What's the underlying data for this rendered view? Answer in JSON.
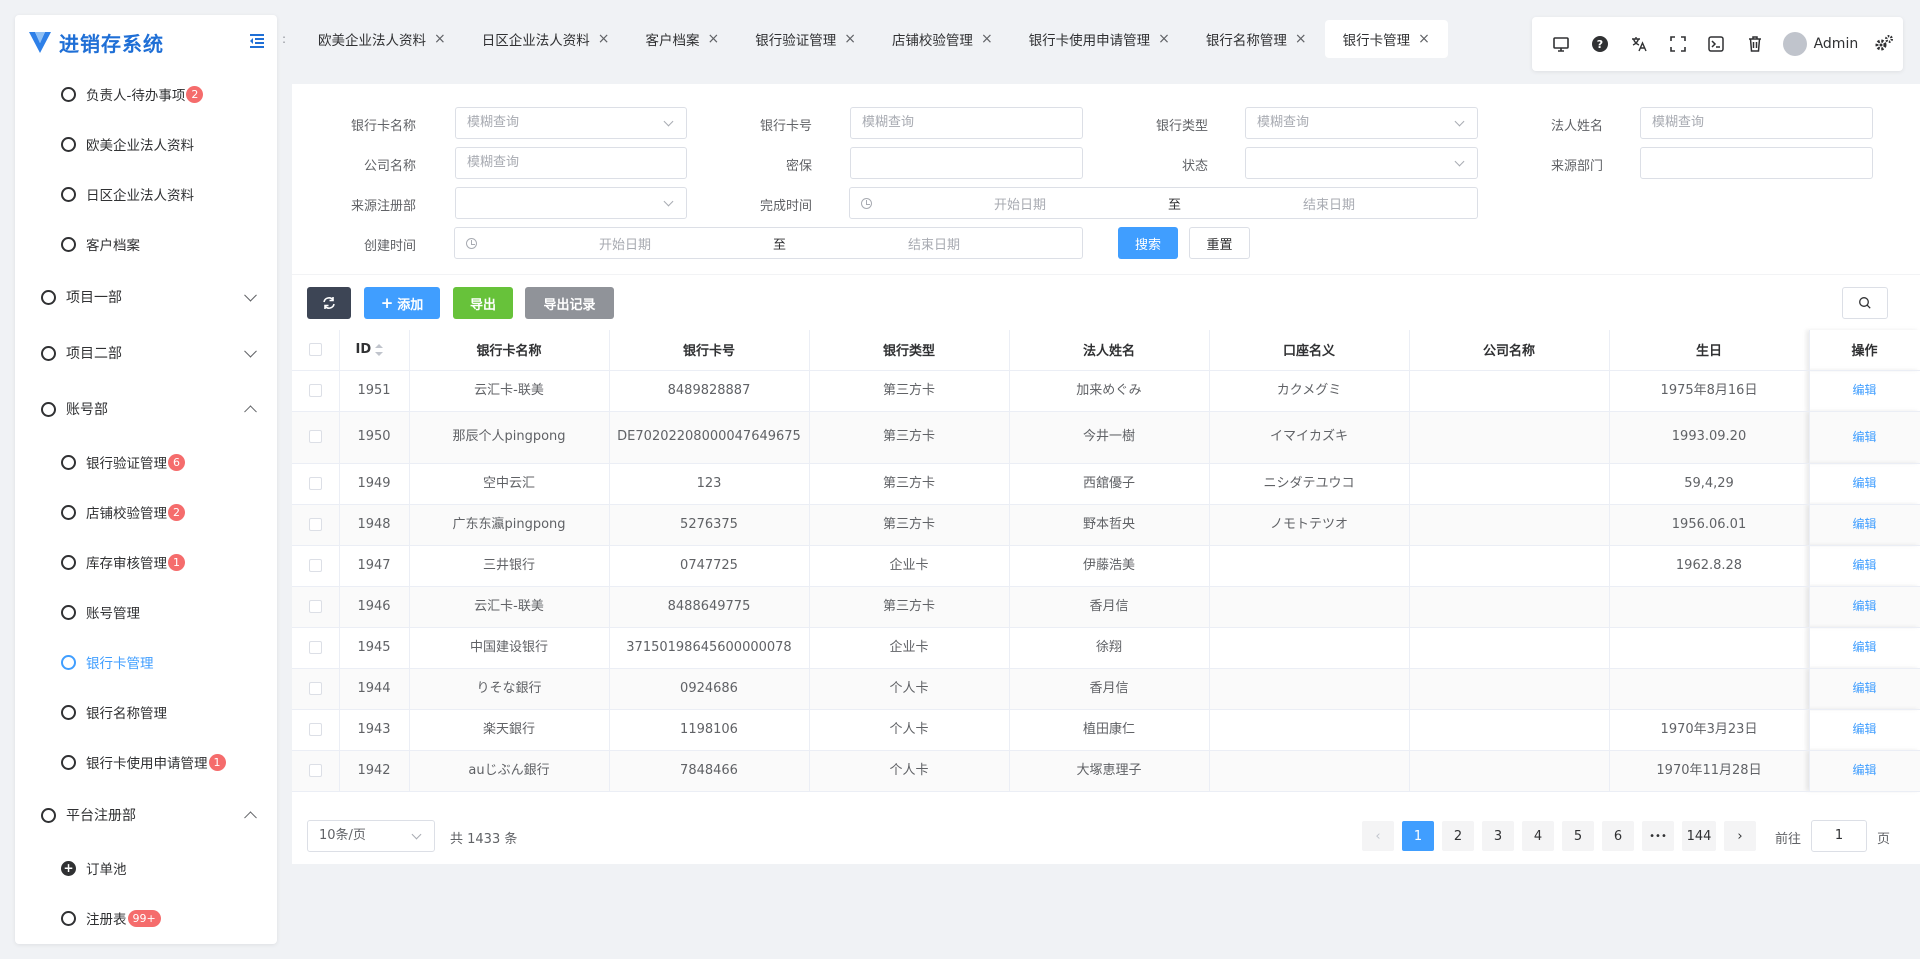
{
  "app": {
    "title": "进销存系统"
  },
  "sidebar": {
    "items": [
      {
        "label": "负责人-待办事项",
        "badge": "2"
      },
      {
        "label": "欧美企业法人资料"
      },
      {
        "label": "日区企业法人资料"
      },
      {
        "label": "客户档案"
      },
      {
        "label": "项目一部"
      },
      {
        "label": "项目二部"
      },
      {
        "label": "账号部"
      },
      {
        "label": "银行验证管理",
        "badge": "6"
      },
      {
        "label": "店铺校验管理",
        "badge": "2"
      },
      {
        "label": "库存审核管理",
        "badge": "1"
      },
      {
        "label": "账号管理"
      },
      {
        "label": "银行卡管理"
      },
      {
        "label": "银行名称管理"
      },
      {
        "label": "银行卡使用申请管理",
        "badge": "1"
      },
      {
        "label": "平台注册部"
      },
      {
        "label": "订单池"
      },
      {
        "label": "注册表",
        "badge": "99+"
      }
    ]
  },
  "tabs": [
    {
      "label": "欧美企业法人资料"
    },
    {
      "label": "日区企业法人资料"
    },
    {
      "label": "客户档案"
    },
    {
      "label": "银行验证管理"
    },
    {
      "label": "店铺校验管理"
    },
    {
      "label": "银行卡使用申请管理"
    },
    {
      "label": "银行名称管理"
    },
    {
      "label": "银行卡管理"
    }
  ],
  "topbar": {
    "user": "Admin",
    "tabs_scroll": ":"
  },
  "filter": {
    "card_name_label": "银行卡名称",
    "card_name_placeholder": "模糊查询",
    "card_no_label": "银行卡号",
    "card_no_placeholder": "模糊查询",
    "bank_type_label": "银行类型",
    "bank_type_placeholder": "模糊查询",
    "legal_name_label": "法人姓名",
    "legal_name_placeholder": "模糊查询",
    "company_label": "公司名称",
    "company_placeholder": "模糊查询",
    "secret_label": "密保",
    "status_label": "状态",
    "source_dept_label": "来源部门",
    "source_reg_label": "来源注册部",
    "finish_time_label": "完成时间",
    "create_time_label": "创建时间",
    "start_date": "开始日期",
    "to": "至",
    "end_date": "结束日期",
    "search_btn": "搜索",
    "reset_btn": "重置"
  },
  "toolbar": {
    "add": "添加",
    "export": "导出",
    "export_log": "导出记录"
  },
  "table": {
    "headers": [
      "ID",
      "银行卡名称",
      "银行卡号",
      "银行类型",
      "法人姓名",
      "口座名义",
      "公司名称",
      "生日",
      "操作"
    ],
    "edit_label": "编辑",
    "rows": [
      [
        "1951",
        "云汇卡-联美",
        "8489828887",
        "第三方卡",
        "加来めぐみ",
        "カクメグミ",
        "",
        "1975年8月16日"
      ],
      [
        "1950",
        "那辰个人pingpong",
        "DE70202208000047649675",
        "第三方卡",
        "今井一樹",
        "イマイカズキ",
        "",
        "1993.09.20"
      ],
      [
        "1949",
        "空中云汇",
        "123",
        "第三方卡",
        "西舘優子",
        "ニシダテユウコ",
        "",
        "59,4,29"
      ],
      [
        "1948",
        "广东东瀛pingpong",
        "5276375",
        "第三方卡",
        "野本哲央",
        "ノモトテツオ",
        "",
        "1956.06.01"
      ],
      [
        "1947",
        "三井银行",
        "0747725",
        "企业卡",
        "伊藤浩美",
        "",
        "",
        "1962.8.28"
      ],
      [
        "1946",
        "云汇卡-联美",
        "8488649775",
        "第三方卡",
        "香月信",
        "",
        "",
        ""
      ],
      [
        "1945",
        "中国建设银行",
        "37150198645600000078",
        "企业卡",
        "徐翔",
        "",
        "",
        ""
      ],
      [
        "1944",
        "りそな銀行",
        "0924686",
        "个人卡",
        "香月信",
        "",
        "",
        ""
      ],
      [
        "1943",
        "楽天銀行",
        "1198106",
        "个人卡",
        "植田康仁",
        "",
        "",
        "1970年3月23日"
      ],
      [
        "1942",
        "auじぶん銀行",
        "7848466",
        "个人卡",
        "大塚恵理子",
        "",
        "",
        "1970年11月28日"
      ]
    ]
  },
  "pagination": {
    "page_size": "10条/页",
    "total": "共 1433 条",
    "pages": [
      "1",
      "2",
      "3",
      "4",
      "5",
      "6",
      "•••",
      "144"
    ],
    "goto_label": "前往",
    "goto_value": "1",
    "page_unit": "页"
  },
  "colors": {
    "primary": "#409eff",
    "brand": "#1f6fd6",
    "success": "#67c23a",
    "danger": "#f56c6c",
    "dark": "#3d4555"
  }
}
